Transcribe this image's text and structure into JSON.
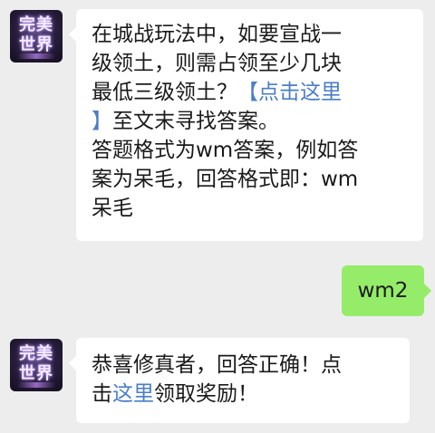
{
  "messages": [
    {
      "sender": "bot",
      "lines": [
        {
          "text": "在城战玩法中，如要宣战一"
        },
        {
          "text": "级领土，则需占领至少几块"
        },
        {
          "text": "最低三级领土？",
          "link": "【点击这里"
        },
        {
          "link": "】",
          "text": "至文末寻找答案。"
        },
        {
          "text": "答题格式为wm答案，例如答"
        },
        {
          "text": "案为呆毛，回答格式即：wm"
        },
        {
          "text": "呆毛"
        }
      ]
    },
    {
      "sender": "me",
      "text": "wm2"
    },
    {
      "sender": "bot",
      "lines": [
        {
          "text": "恭喜修真者，回答正确！点"
        },
        {
          "text": "击",
          "link": "这里",
          "tail": "领取奖励！"
        }
      ]
    }
  ],
  "avatar": {
    "logo_line1": "完美",
    "logo_line2": "世界"
  }
}
